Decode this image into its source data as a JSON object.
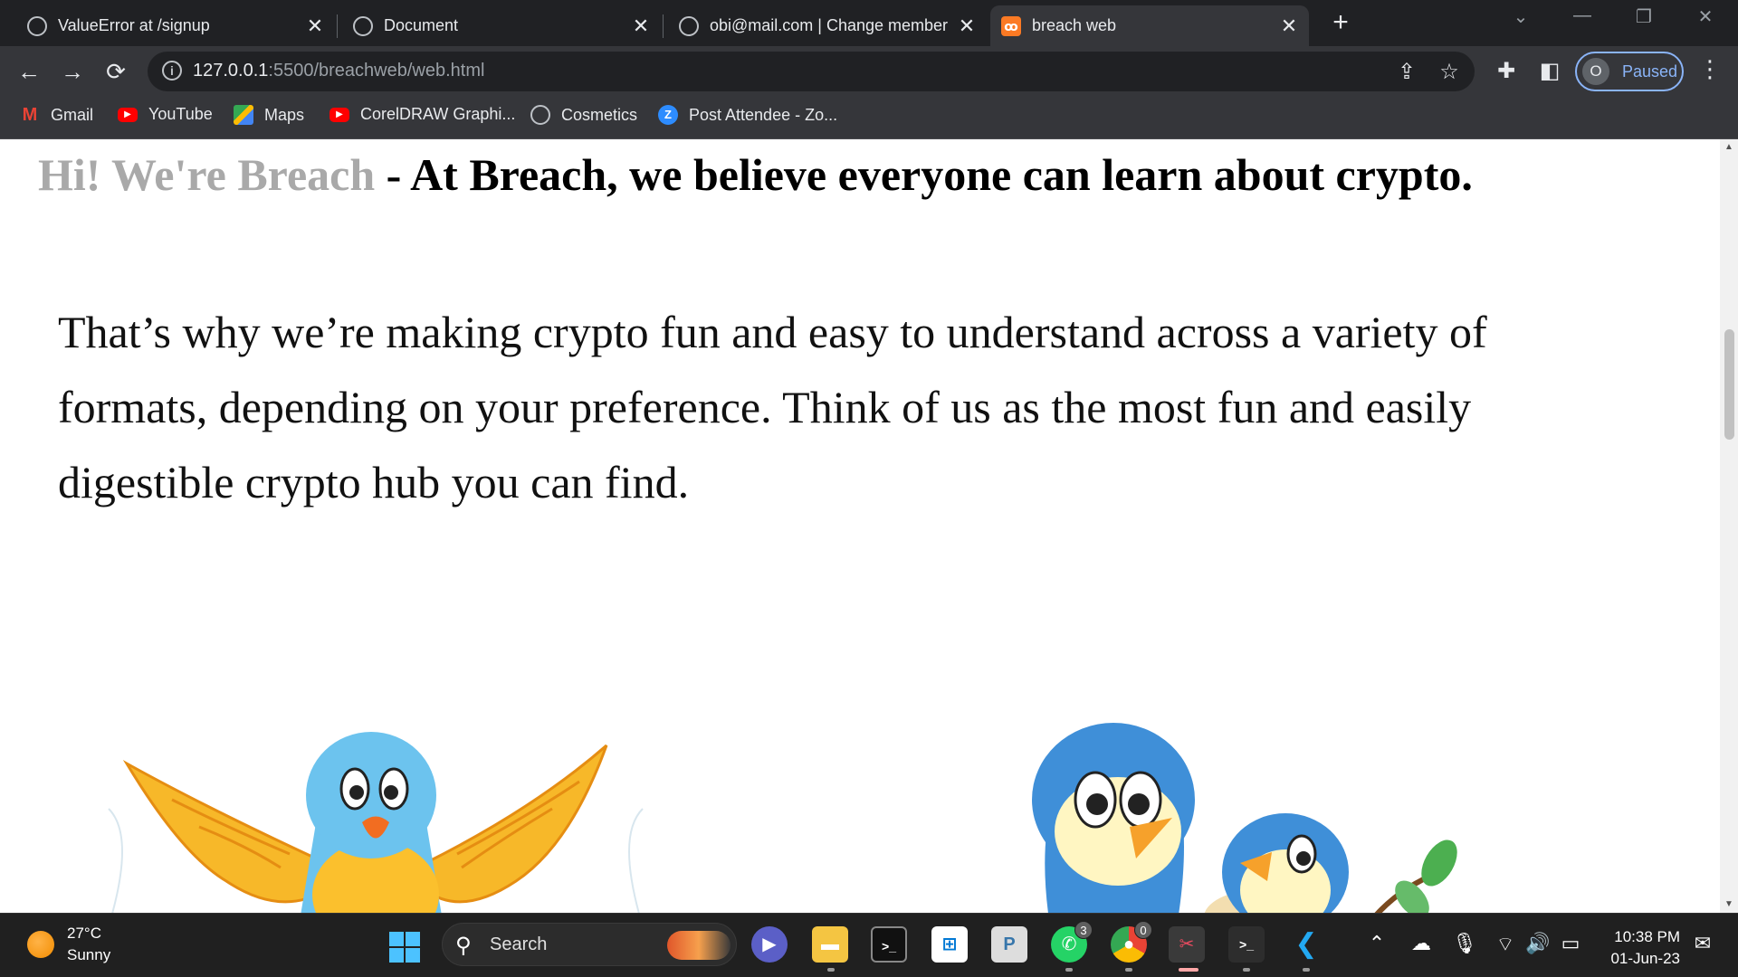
{
  "browser": {
    "tabs": [
      {
        "title": "ValueError at /signup",
        "icon": "globe-icon",
        "active": false
      },
      {
        "title": "Document",
        "icon": "globe-icon",
        "active": false
      },
      {
        "title": "obi@mail.com | Change member",
        "icon": "globe-icon",
        "active": false
      },
      {
        "title": "breach web",
        "icon": "xampp-icon",
        "active": true
      }
    ],
    "tab_close_glyph": "✕",
    "new_tab_glyph": "+",
    "window_controls": [
      "⌄",
      "—",
      "❐",
      "✕"
    ],
    "url_host": "127.0.0.1",
    "url_rest": ":5500/breachweb/web.html",
    "profile": {
      "initial": "O",
      "status": "Paused"
    },
    "bookmarks": [
      {
        "label": "Gmail",
        "icon": "gmail-icon"
      },
      {
        "label": "YouTube",
        "icon": "youtube-icon"
      },
      {
        "label": "Maps",
        "icon": "maps-icon"
      },
      {
        "label": "CorelDRAW Graphi...",
        "icon": "youtube-icon"
      },
      {
        "label": "Cosmetics",
        "icon": "globe-icon"
      },
      {
        "label": "Post Attendee - Zo...",
        "icon": "zoom-icon"
      }
    ]
  },
  "page": {
    "headline_grey": "Hi! We're Breach",
    "headline_rest": " - At Breach, we believe everyone can learn about crypto.",
    "paragraph": "That’s why we’re making crypto fun and easy to understand across a variety of formats, depending on your preference. Think of us as the most fun and easily digestible crypto hub you can find."
  },
  "taskbar": {
    "weather_temp": "27°C",
    "weather_desc": "Sunny",
    "search_label": "Search",
    "whatsapp_badge": "3",
    "chrome_badge": "0",
    "time": "10:38 PM",
    "date": "01-Jun-23"
  },
  "colors": {
    "accent": "#8ab4f8",
    "headline_grey": "#a9a9a9",
    "page_bg": "#ffffff",
    "chrome_bg": "#202124"
  }
}
